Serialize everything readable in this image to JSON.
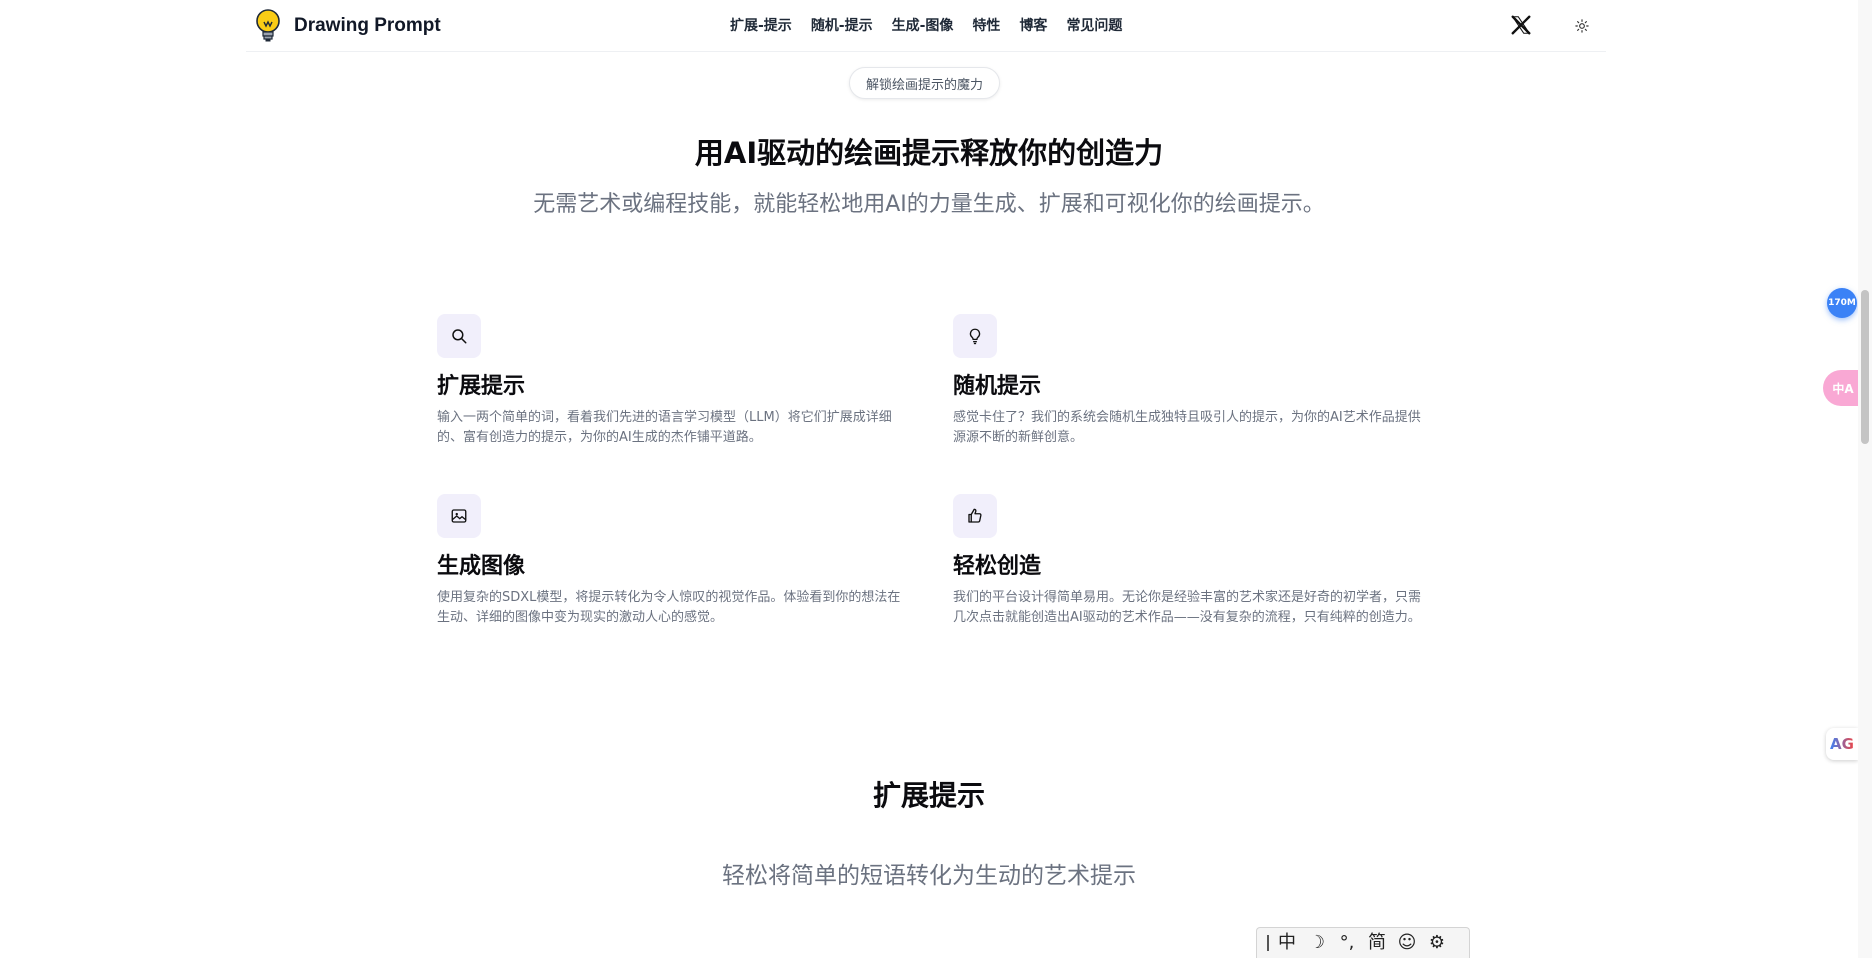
{
  "header": {
    "brand": "Drawing Prompt",
    "nav": [
      "扩展-提示",
      "随机-提示",
      "生成-图像",
      "特性",
      "博客",
      "常见问题"
    ]
  },
  "hero": {
    "pill": "解锁绘画提示的魔力",
    "title": "用AI驱动的绘画提示释放你的创造力",
    "subtitle": "无需艺术或编程技能，就能轻松地用AI的力量生成、扩展和可视化你的绘画提示。"
  },
  "features": [
    {
      "icon": "search-icon",
      "title": "扩展提示",
      "desc": "输入一两个简单的词，看着我们先进的语言学习模型（LLM）将它们扩展成详细的、富有创造力的提示，为你的AI生成的杰作铺平道路。"
    },
    {
      "icon": "lightbulb-icon",
      "title": "随机提示",
      "desc": "感觉卡住了？我们的系统会随机生成独特且吸引人的提示，为你的AI艺术作品提供源源不断的新鲜创意。"
    },
    {
      "icon": "image-icon",
      "title": "生成图像",
      "desc": "使用复杂的SDXL模型，将提示转化为令人惊叹的视觉作品。体验看到你的想法在生动、详细的图像中变为现实的激动人心的感觉。"
    },
    {
      "icon": "thumbs-up-icon",
      "title": "轻松创造",
      "desc": "我们的平台设计得简单易用。无论你是经验丰富的艺术家还是好奇的初学者，只需几次点击就能创造出AI驱动的艺术作品——没有复杂的流程，只有纯粹的创造力。"
    }
  ],
  "section": {
    "title": "扩展提示",
    "subtitle": "轻松将简单的短语转化为生动的艺术提示"
  },
  "widgets": {
    "badge": "170M",
    "translate": "中A",
    "ag": "AG"
  },
  "ime": {
    "items": [
      "中",
      "☽",
      "°,",
      "简",
      "☺",
      "⚙"
    ]
  },
  "colors": {
    "icon_bg": "#f1effb",
    "badge": "#3b82f6",
    "translate": "#f9a8d4"
  }
}
